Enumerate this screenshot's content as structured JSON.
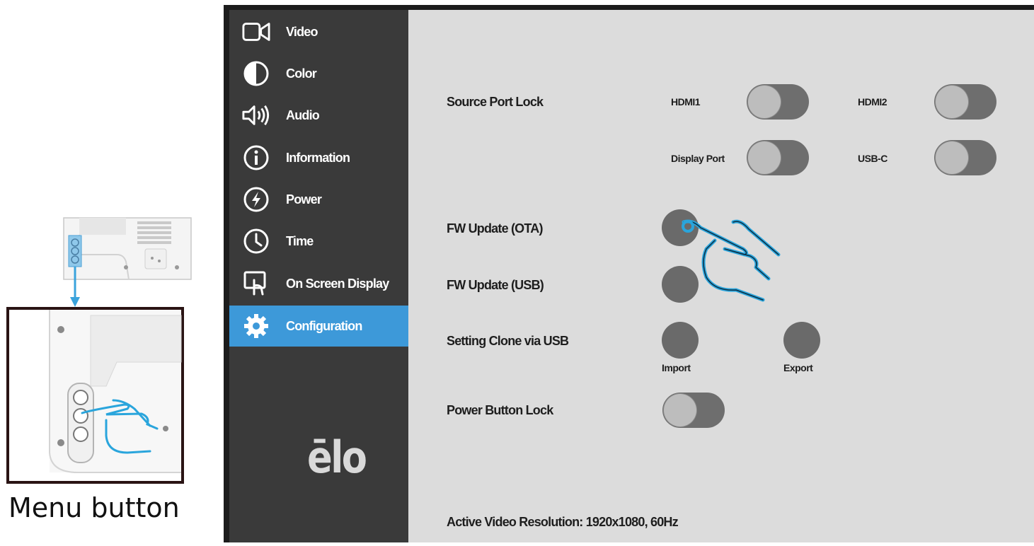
{
  "caption": "Menu button",
  "sidebar": {
    "items": [
      {
        "label": "Video",
        "icon": "video-camera-icon"
      },
      {
        "label": "Color",
        "icon": "contrast-icon"
      },
      {
        "label": "Audio",
        "icon": "speaker-icon"
      },
      {
        "label": "Information",
        "icon": "info-icon"
      },
      {
        "label": "Power",
        "icon": "power-bolt-icon"
      },
      {
        "label": "Time",
        "icon": "clock-icon"
      },
      {
        "label": "On Screen Display",
        "icon": "touch-screen-icon"
      },
      {
        "label": "Configuration",
        "icon": "gear-icon"
      }
    ],
    "active": "Configuration",
    "logo_text": "ēlo"
  },
  "settings": {
    "source_port_lock": {
      "label": "Source Port Lock",
      "ports": [
        "HDMI1",
        "HDMI2",
        "Display Port",
        "USB-C"
      ]
    },
    "fw_update_ota": {
      "label": "FW Update (OTA)"
    },
    "fw_update_usb": {
      "label": "FW Update (USB)"
    },
    "setting_clone": {
      "label": "Setting Clone via USB",
      "import_label": "Import",
      "export_label": "Export"
    },
    "power_button_lock": {
      "label": "Power Button Lock"
    }
  },
  "status": {
    "text": "Active Video Resolution:  1920x1080, 60Hz"
  },
  "colors": {
    "accent": "#3d99d9",
    "sidebar": "#3a3a3a",
    "panel": "#dcdcdc",
    "toggle_track": "#6e6e6e",
    "hand_outline": "#2aa5dc"
  }
}
